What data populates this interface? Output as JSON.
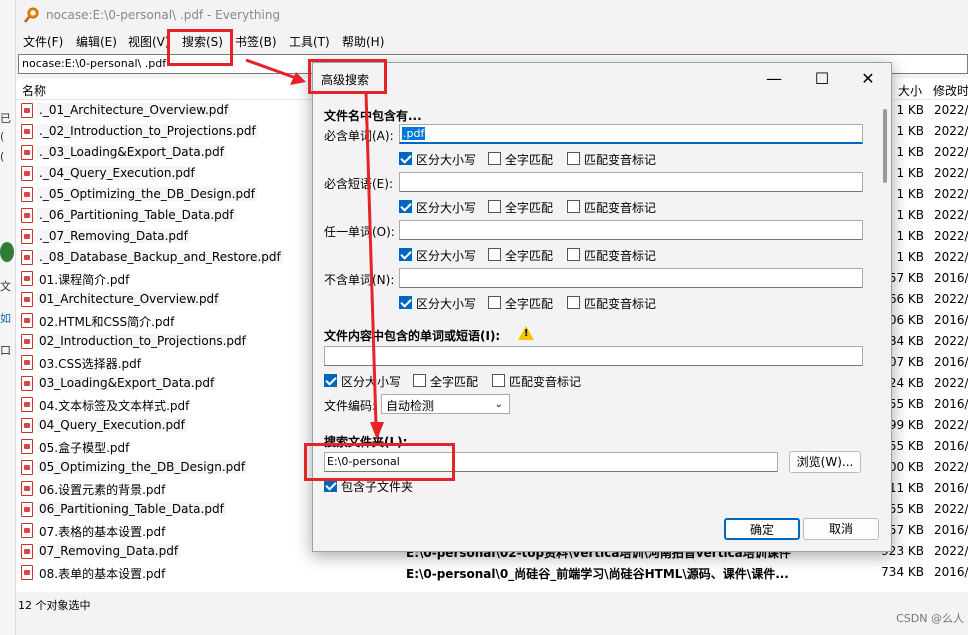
{
  "window": {
    "title": "nocase:E:\\0-personal\\ .pdf - Everything"
  },
  "menu": [
    "文件(F)",
    "编辑(E)",
    "视图(V)",
    "搜索(S)",
    "书签(B)",
    "工具(T)",
    "帮助(H)"
  ],
  "search": {
    "value": "nocase:E:\\0-personal\\ .pdf"
  },
  "columns": {
    "name": "名称",
    "size": "大小",
    "date": "修改时"
  },
  "rows": [
    {
      "name": "._01_Architecture_Overview.pdf",
      "path": "",
      "size": "1 KB",
      "date": "2022/"
    },
    {
      "name": "._02_Introduction_to_Projections.pdf",
      "path": "",
      "size": "1 KB",
      "date": "2022/"
    },
    {
      "name": "._03_Loading&Export_Data.pdf",
      "path": "",
      "size": "1 KB",
      "date": "2022/"
    },
    {
      "name": "._04_Query_Execution.pdf",
      "path": "",
      "size": "1 KB",
      "date": "2022/"
    },
    {
      "name": "._05_Optimizing_the_DB_Design.pdf",
      "path": "",
      "size": "1 KB",
      "date": "2022/"
    },
    {
      "name": "._06_Partitioning_Table_Data.pdf",
      "path": "",
      "size": "1 KB",
      "date": "2022/"
    },
    {
      "name": "._07_Removing_Data.pdf",
      "path": "",
      "size": "1 KB",
      "date": "2022/"
    },
    {
      "name": "._08_Database_Backup_and_Restore.pdf",
      "path": "",
      "size": "1 KB",
      "date": "2022/"
    },
    {
      "name": "01.课程简介.pdf",
      "path": "",
      "size": "57 KB",
      "date": "2016/"
    },
    {
      "name": "01_Architecture_Overview.pdf",
      "path": "",
      "size": "66 KB",
      "date": "2022/"
    },
    {
      "name": "02.HTML和CSS简介.pdf",
      "path": "",
      "size": "06 KB",
      "date": "2016/"
    },
    {
      "name": "02_Introduction_to_Projections.pdf",
      "path": "",
      "size": "84 KB",
      "date": "2022/"
    },
    {
      "name": "03.CSS选择器.pdf",
      "path": "",
      "size": "07 KB",
      "date": "2016/"
    },
    {
      "name": "03_Loading&Export_Data.pdf",
      "path": "",
      "size": "24 KB",
      "date": "2022/"
    },
    {
      "name": "04.文本标签及文本样式.pdf",
      "path": "",
      "size": "55 KB",
      "date": "2016/"
    },
    {
      "name": "04_Query_Execution.pdf",
      "path": "",
      "size": "99 KB",
      "date": "2022/"
    },
    {
      "name": "05.盒子模型.pdf",
      "path": "",
      "size": "55 KB",
      "date": "2016/"
    },
    {
      "name": "05_Optimizing_the_DB_Design.pdf",
      "path": "",
      "size": "00 KB",
      "date": "2022/"
    },
    {
      "name": "06.设置元素的背景.pdf",
      "path": "",
      "size": "11 KB",
      "date": "2016/"
    },
    {
      "name": "06_Partitioning_Table_Data.pdf",
      "path": "",
      "size": "55 KB",
      "date": "2022/"
    },
    {
      "name": "07.表格的基本设置.pdf",
      "path": "",
      "size": "57 KB",
      "date": "2016/"
    },
    {
      "name": "07_Removing_Data.pdf",
      "path": "E:\\0-personal\\02-top资料\\vertica培训\\河南拍音vertica培训课件",
      "size": "923 KB",
      "date": "2022/"
    },
    {
      "name": "08.表单的基本设置.pdf",
      "path": "E:\\0-personal\\0_尚硅谷_前端学习\\尚硅谷HTML\\源码、课件\\课件...",
      "size": "734 KB",
      "date": "2016/"
    }
  ],
  "status": {
    "text": "12 个对象选中"
  },
  "watermark": "CSDN @么人",
  "left_strip": [
    "已",
    "(",
    "(",
    "文",
    "如",
    "口"
  ],
  "dialog": {
    "title": "高级搜索",
    "section1": "文件名中包含有...",
    "must_word_label": "必含单词(A):",
    "must_word_value": ".pdf",
    "must_phrase_label": "必含短语(E):",
    "any_word_label": "任一单词(O):",
    "not_word_label": "不含单词(N):",
    "opt_case": "区分大小写",
    "opt_whole": "全字匹配",
    "opt_diacritics": "匹配变音标记",
    "section2": "文件内容中包含的单词或短语(I):",
    "encoding_label": "文件编码:",
    "encoding_value": "自动检测",
    "section3": "搜索文件夹(L):",
    "folder_value": "E:\\0-personal",
    "browse_label": "浏览(W)...",
    "include_sub_label": "包含子文件夹",
    "ok_label": "确定",
    "cancel_label": "取消"
  }
}
